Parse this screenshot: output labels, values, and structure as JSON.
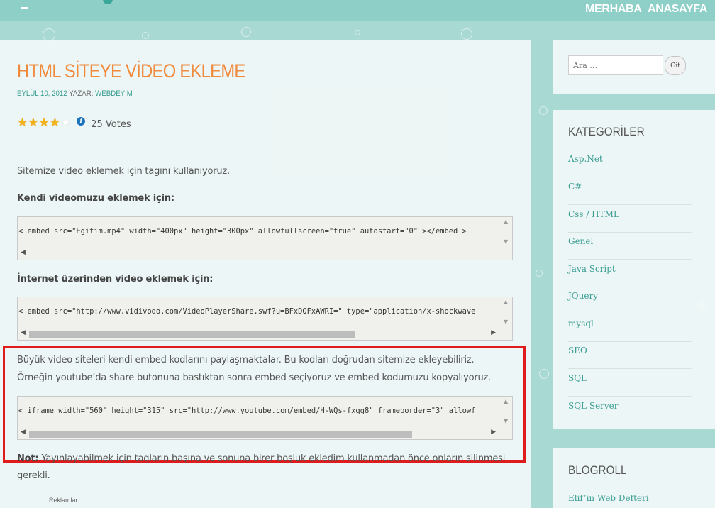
{
  "nav": {
    "items": [
      "MERHABA",
      "ANASAYFA"
    ]
  },
  "post": {
    "title": "HTML SİTEYE VİDEO EKLEME",
    "date": "EYLÜL 10, 2012",
    "author_prefix": "YAZAR:",
    "author": "WEBDEYİM",
    "rating": {
      "stars_filled": 4,
      "stars_total": 5,
      "votes": "25 Votes"
    },
    "intro": "Sitemize video eklemek için tagını kullanıyoruz.",
    "heading_own": "Kendi videomuzu eklemek için:",
    "code_own": "< embed src=\"Egitim.mp4\" width=\"400px\" height=\"300px\"  allowfullscreen=\"true\" autostart=\"0\" ></embed >",
    "heading_internet": "İnternet  üzerinden video eklemek için:",
    "code_internet": "< embed src=\"http://www.vidivodo.com/VideoPlayerShare.swf?u=BFxDQFxAWRI=\" type=\"application/x-shockwave",
    "para1": "Büyük video siteleri kendi embed kodlarını paylaşmaktalar. Bu kodları doğrudan sitemize ekleyebiliriz.",
    "para2": "Örneğin youtube’da share butonuna bastıktan sonra embed seçiyoruz ve embed kodumuzu kopyalıyoruz.",
    "code_youtube": "< iframe width=\"560\" height=\"315\" src=\"http://www.youtube.com/embed/H-WQs-fxqg8\" frameborder=\"3\" allowf",
    "note_label": "Not:",
    "note_text": " Yayınlayabilmek için tagların başına ve sonuna birer boşluk ekledim kullanmadan önce onların silinmesi",
    "note_text2": "gerekli.",
    "ads_label": "Reklamlar"
  },
  "sidebar": {
    "search": {
      "placeholder": "Ara …",
      "button": "Git"
    },
    "categories_title": "KATEGORİLER",
    "categories": [
      "Asp.Net",
      "C#",
      "Css / HTML",
      "Genel",
      "Java Script",
      "JQuery",
      "mysql",
      "SEO",
      "SQL",
      "SQL Server"
    ],
    "blogroll_title": "BLOGROLL",
    "blogroll": [
      "Elif’in Web Defteri"
    ]
  },
  "colors": {
    "accent_orange": "#f08a3c",
    "link_teal": "#3a9e93",
    "highlight_red": "#e01b1b",
    "background": "#a9d9d3"
  }
}
